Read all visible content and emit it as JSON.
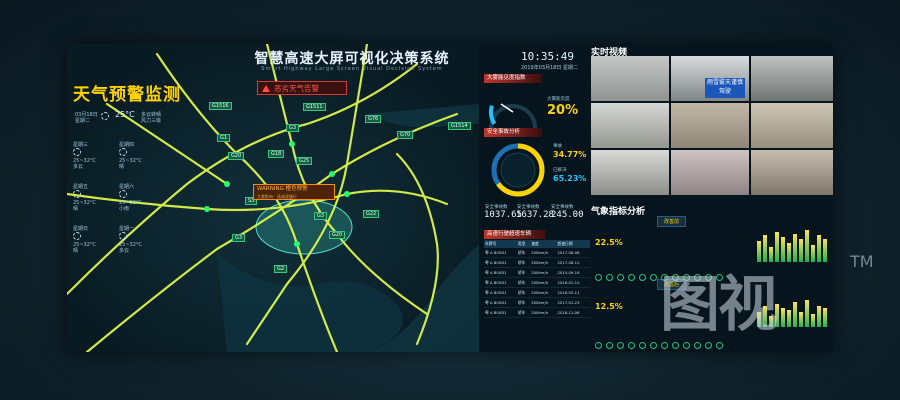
{
  "header": {
    "title": "智慧高速大屏可视化决策系统",
    "subtitle": "Smart Highway Large Screen Visual Decision System",
    "clock": "10:35:49",
    "date": "2019年03月18日  星期二"
  },
  "weather": {
    "title": "天气预警监测",
    "current": {
      "date": "03月18日",
      "day": "星期二",
      "temp": "25°C",
      "desc": "多云转晴",
      "wind": "风力三级"
    },
    "forecast": [
      {
        "day": "星期三",
        "temp": "25~32°C",
        "desc": "多云"
      },
      {
        "day": "星期四",
        "temp": "25~32°C",
        "desc": "晴"
      },
      {
        "day": "星期五",
        "temp": "25~32°C",
        "desc": "晴"
      },
      {
        "day": "星期六",
        "temp": "25~32°C",
        "desc": "小雨"
      },
      {
        "day": "星期日",
        "temp": "25~32°C",
        "desc": "晴"
      },
      {
        "day": "星期一",
        "temp": "25~32°C",
        "desc": "多云"
      }
    ]
  },
  "alerts": {
    "severe": "恶劣天气告警",
    "warning_title": "WARNING 橙色预警",
    "warning_detail": "大雾影响 · 请减速慢行"
  },
  "roads": [
    "G1516",
    "G1511",
    "G1",
    "G3",
    "G76",
    "G1514",
    "G18",
    "G70",
    "G20",
    "G25",
    "S3",
    "G3",
    "G22",
    "G20",
    "G3",
    "G2"
  ],
  "visibility": {
    "head": "大雾能见度指数",
    "label": "大雾能见度",
    "value": "20%",
    "fraction": 0.2
  },
  "safety": {
    "head": "安全事故分析",
    "legend": [
      {
        "label": "事故",
        "value": "34.77%"
      },
      {
        "label": "已解决",
        "value": "65.23%"
      }
    ],
    "fraction": 0.6523
  },
  "stats": {
    "labels": [
      "安全事故数",
      "安全事故数",
      "安全事故数"
    ],
    "values": [
      "1037.65",
      "1637.28",
      "245.00"
    ]
  },
  "table": {
    "head": "高速行驶超速车辆",
    "columns": [
      "车牌号",
      "类型",
      "速度",
      "超速日期"
    ],
    "rows": [
      [
        "粤 A BO831",
        "轿车",
        "200km/h",
        "2017-06-08"
      ],
      [
        "粤 A BO831",
        "轿车",
        "200km/h",
        "2017-08-12"
      ],
      [
        "粤 A BO831",
        "轿车",
        "200km/h",
        "2015-09-16"
      ],
      [
        "粤 A BO831",
        "轿车",
        "200km/h",
        "2016-01-10"
      ],
      [
        "粤 A BO831",
        "轿车",
        "200km/h",
        "2016-05-11"
      ],
      [
        "粤 A BO831",
        "轿车",
        "200km/h",
        "2017-01-23"
      ],
      [
        "粤 A BO831",
        "轿车",
        "200km/h",
        "2018-11-06"
      ]
    ]
  },
  "video": {
    "title": "实时视频",
    "sign_text": "雨雪雾天谨慎驾驶"
  },
  "metrics": {
    "title": "气象指标分析",
    "tab_before": "改善前",
    "tab_after": "改善后",
    "pct_before": "22.5%",
    "pct_after": "12.5%",
    "bars_before": [
      55,
      70,
      40,
      80,
      65,
      50,
      75,
      60,
      85,
      45,
      70,
      60
    ],
    "bars_after": [
      40,
      55,
      30,
      60,
      50,
      45,
      65,
      40,
      70,
      35,
      55,
      50
    ]
  },
  "watermark": "图视",
  "trademark": "TM",
  "colors": {
    "accent": "#ffd200",
    "alert": "#d23c2c",
    "road": "#e7ff4a",
    "cyan": "#1fc4ff"
  }
}
